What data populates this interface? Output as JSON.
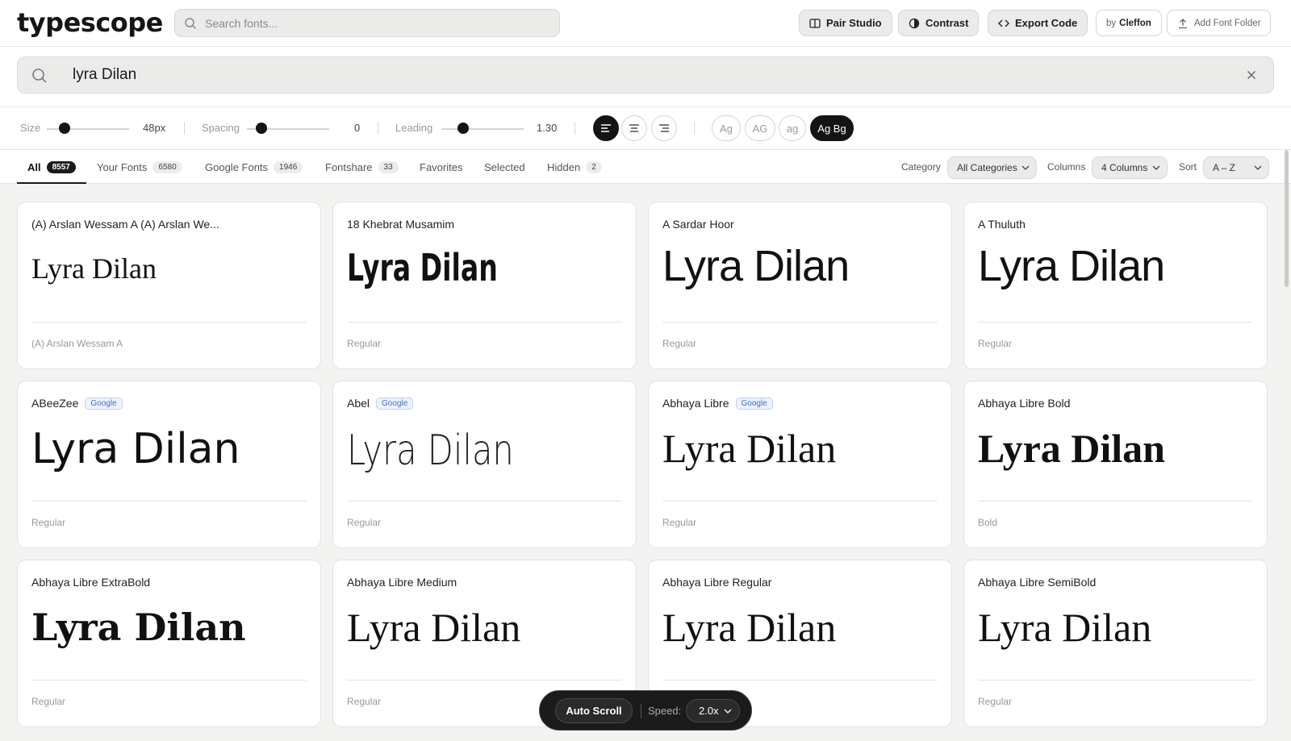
{
  "app": {
    "logo": "typescope"
  },
  "topbar": {
    "search_placeholder": "Search fonts...",
    "pair_studio": "Pair Studio",
    "contrast": "Contrast",
    "export_code": "Export Code",
    "by_prefix": "by",
    "by_name": "Cleffon",
    "add_font_folder": "Add Font Folder"
  },
  "preview": {
    "text": "lyra Dilan"
  },
  "controls": {
    "size_label": "Size",
    "size_value": "48px",
    "size_level": 0.22,
    "spacing_label": "Spacing",
    "spacing_value": "0",
    "spacing_level": 0.18,
    "leading_label": "Leading",
    "leading_value": "1.30",
    "leading_level": 0.26,
    "align_options": [
      "left",
      "center",
      "right"
    ],
    "align_active": "left",
    "case_options": [
      "Ag",
      "AG",
      "ag",
      "Ag Bg"
    ],
    "case_active": "Ag Bg"
  },
  "tabs": [
    {
      "label": "All",
      "count": "8557",
      "active": true
    },
    {
      "label": "Your Fonts",
      "count": "6580"
    },
    {
      "label": "Google Fonts",
      "count": "1946"
    },
    {
      "label": "Fontshare",
      "count": "33"
    },
    {
      "label": "Favorites",
      "count": ""
    },
    {
      "label": "Selected",
      "count": ""
    },
    {
      "label": "Hidden",
      "count": "2"
    }
  ],
  "filters": {
    "category_label": "Category",
    "category_value": "All Categories",
    "columns_label": "Columns",
    "columns_value": "4 Columns",
    "sort_label": "Sort",
    "sort_value": "A – Z"
  },
  "fonts": [
    {
      "name": "(A) Arslan Wessam A (A) Arslan We...",
      "badge": "",
      "style": "(A) Arslan Wessam A",
      "sample": "Lyra Dilan"
    },
    {
      "name": "18 Khebrat Musamim",
      "badge": "",
      "style": "Regular",
      "sample": "Lyra Dilan"
    },
    {
      "name": "A Sardar Hoor",
      "badge": "",
      "style": "Regular",
      "sample": "Lyra Dilan"
    },
    {
      "name": "A Thuluth",
      "badge": "",
      "style": "Regular",
      "sample": "Lyra Dilan"
    },
    {
      "name": "ABeeZee",
      "badge": "Google",
      "style": "Regular",
      "sample": "Lyra Dilan"
    },
    {
      "name": "Abel",
      "badge": "Google",
      "style": "Regular",
      "sample": "Lyra Dilan"
    },
    {
      "name": "Abhaya Libre",
      "badge": "Google",
      "style": "Regular",
      "sample": "Lyra Dilan"
    },
    {
      "name": "Abhaya Libre Bold",
      "badge": "",
      "style": "Bold",
      "sample": "Lyra Dilan"
    },
    {
      "name": "Abhaya Libre ExtraBold",
      "badge": "",
      "style": "Regular",
      "sample": "Lyra Dilan"
    },
    {
      "name": "Abhaya Libre Medium",
      "badge": "",
      "style": "Regular",
      "sample": "Lyra Dilan"
    },
    {
      "name": "Abhaya Libre Regular",
      "badge": "",
      "style": "",
      "sample": "Lyra Dilan"
    },
    {
      "name": "Abhaya Libre SemiBold",
      "badge": "",
      "style": "Regular",
      "sample": "Lyra Dilan"
    }
  ],
  "autoscroll": {
    "label": "Auto Scroll",
    "speed_label": "Speed:",
    "speed_value": "2.0x"
  },
  "colors": {
    "accent": "#141414",
    "badge": "#3b6fd4",
    "background": "#f3f3f1"
  }
}
